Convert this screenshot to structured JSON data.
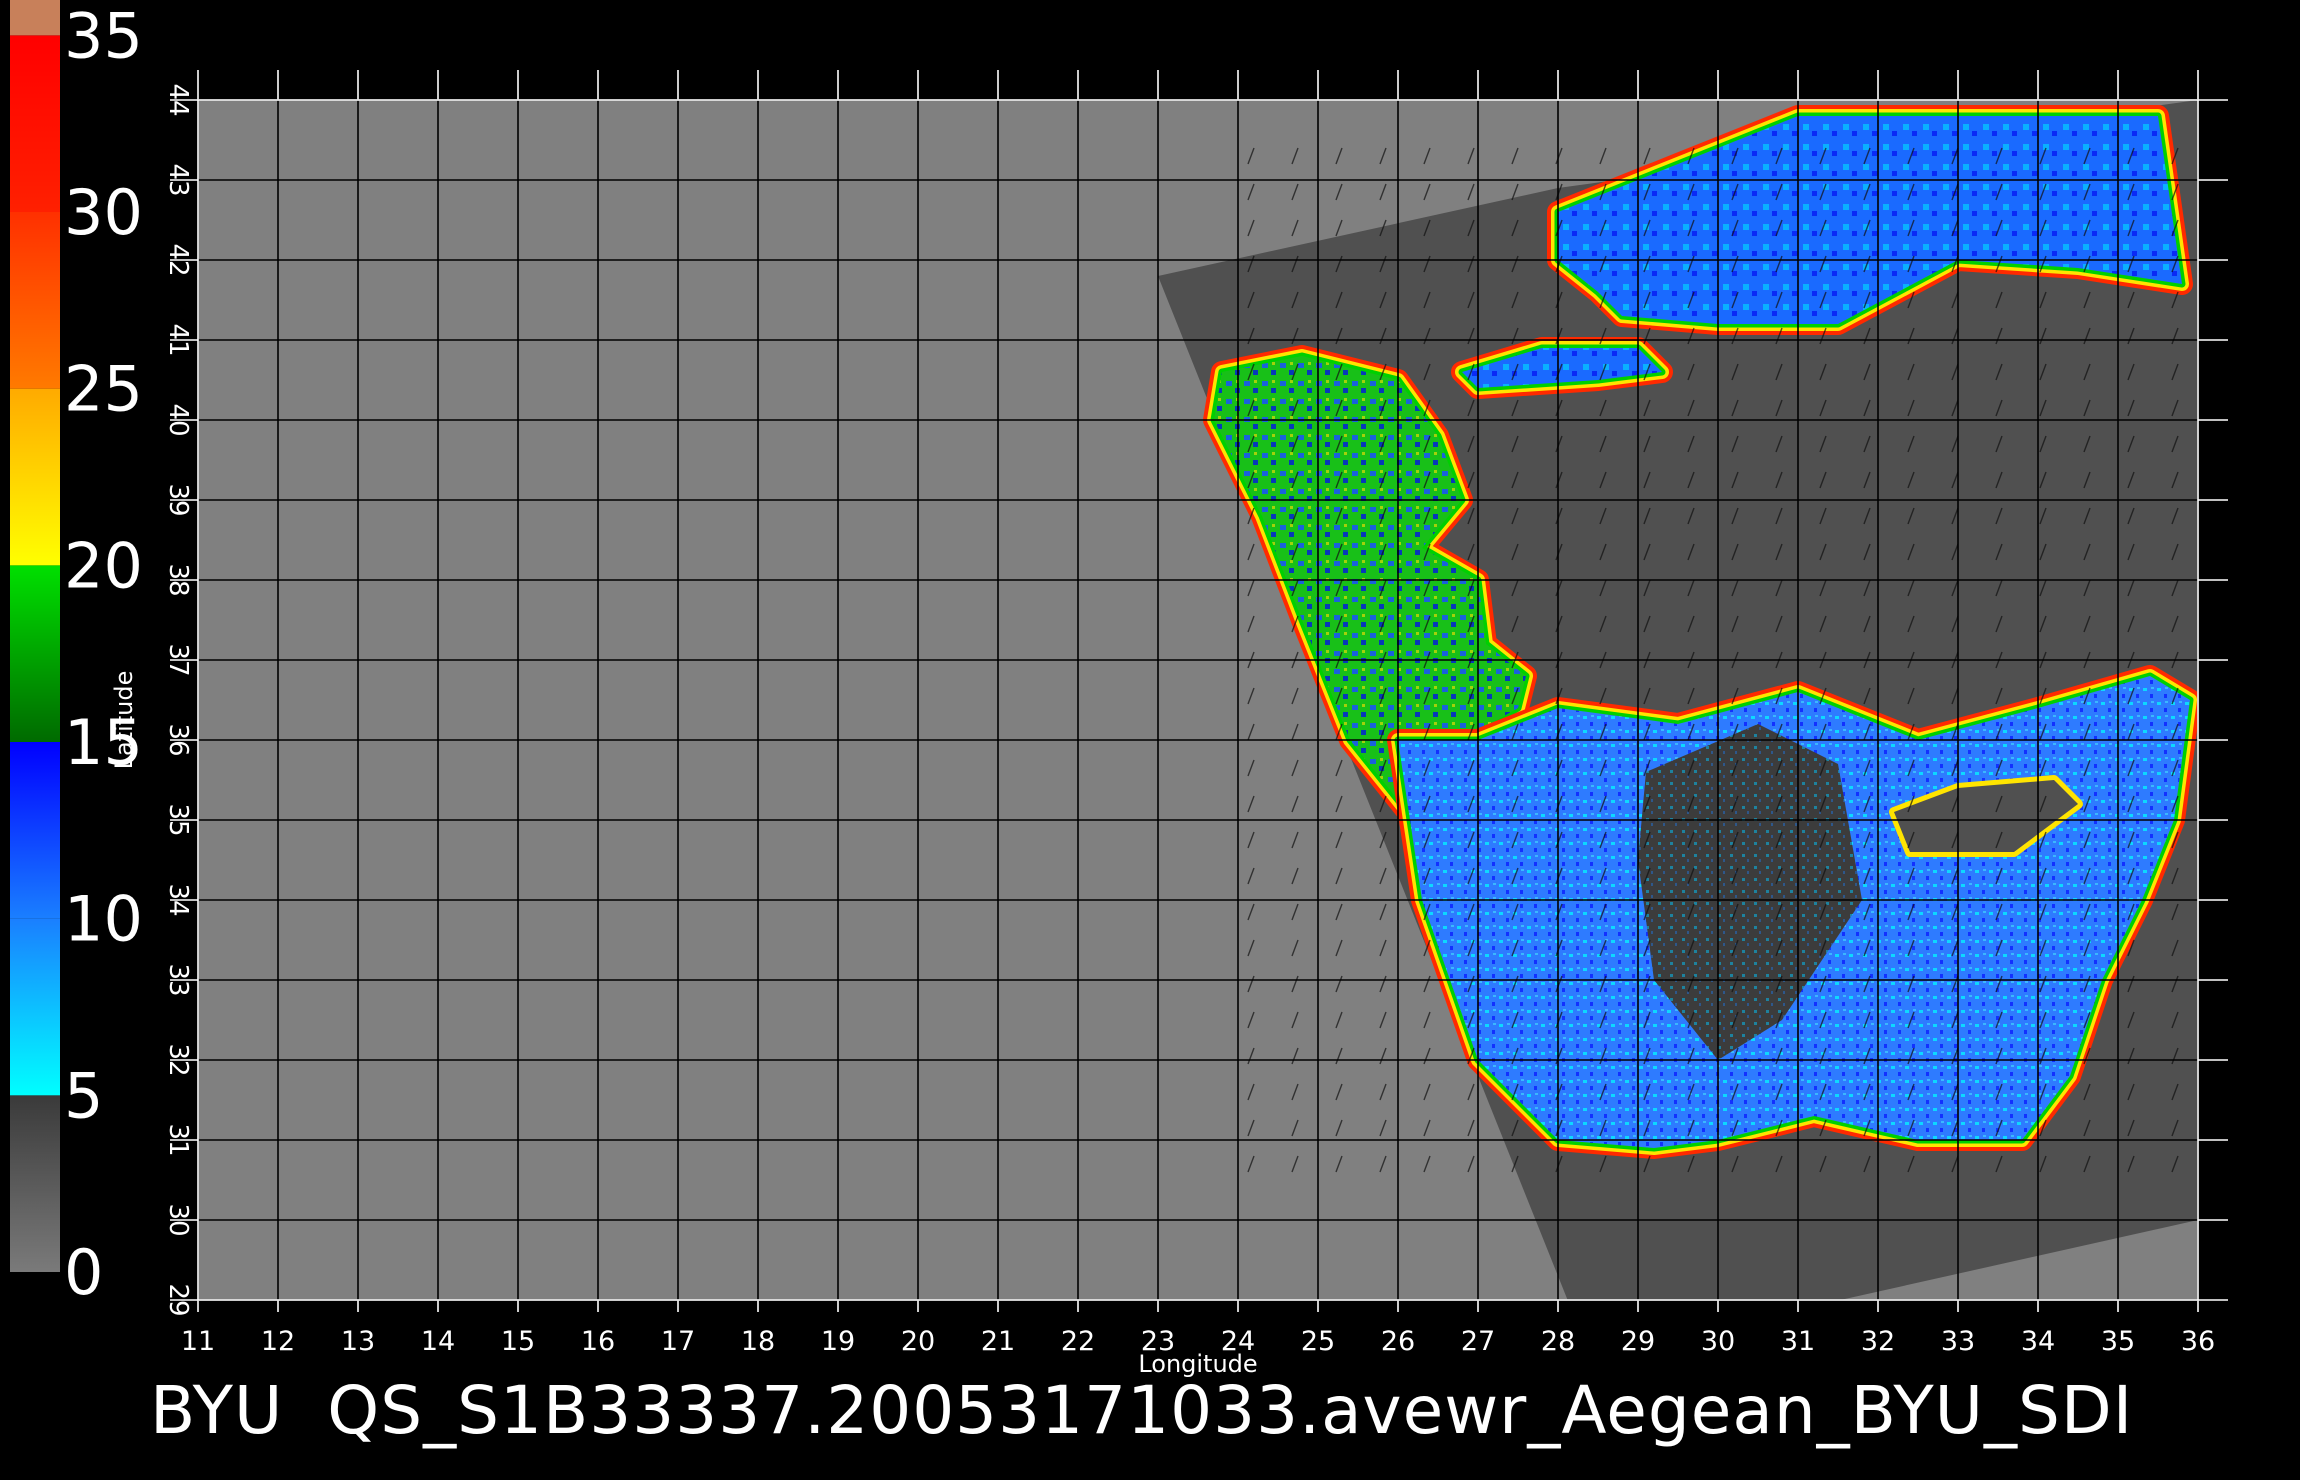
{
  "footer": {
    "caption_prefix": "BYU",
    "caption_file": "QS_S1B33337.20053171033.avewr_Aegean_BYU_SDI"
  },
  "colorbar": {
    "ticks": [
      "0",
      "5",
      "10",
      "15",
      "20",
      "25",
      "30",
      "35"
    ],
    "bands": [
      {
        "from": 0,
        "to": 5,
        "colors": [
          "#7a7a7a",
          "#3a3a3a"
        ]
      },
      {
        "from": 5,
        "to": 10,
        "colors": [
          "#00ffff",
          "#1a7fff"
        ]
      },
      {
        "from": 10,
        "to": 15,
        "colors": [
          "#1a7fff",
          "#0000ff"
        ]
      },
      {
        "from": 15,
        "to": 20,
        "colors": [
          "#006a00",
          "#00e000"
        ]
      },
      {
        "from": 20,
        "to": 25,
        "colors": [
          "#ffff00",
          "#ffaa00"
        ]
      },
      {
        "from": 25,
        "to": 30,
        "colors": [
          "#ff7a00",
          "#ff3000"
        ]
      },
      {
        "from": 30,
        "to": 35,
        "colors": [
          "#ff2000",
          "#ff0000"
        ]
      },
      {
        "from": 35,
        "to": 36,
        "colors": [
          "#c8805a",
          "#c8805a"
        ]
      }
    ]
  },
  "chart_data": {
    "type": "heatmap",
    "title": "",
    "xlabel": "Longitude",
    "ylabel": "Latitude",
    "xlim": [
      11,
      36
    ],
    "ylim": [
      29,
      44
    ],
    "xticks": [
      11,
      12,
      13,
      14,
      15,
      16,
      17,
      18,
      19,
      20,
      21,
      22,
      23,
      24,
      25,
      26,
      27,
      28,
      29,
      30,
      31,
      32,
      33,
      34,
      35,
      36
    ],
    "yticks": [
      29,
      30,
      31,
      32,
      33,
      34,
      35,
      36,
      37,
      38,
      39,
      40,
      41,
      42,
      43,
      44
    ],
    "grid": true,
    "colorscale": {
      "min": 0,
      "max": 35
    },
    "swath_polygon": [
      [
        23.0,
        41.8
      ],
      [
        28.0,
        42.9
      ],
      [
        36.0,
        44.0
      ],
      [
        36.0,
        30.0
      ],
      [
        28.4,
        28.3
      ]
    ],
    "regions": [
      {
        "name_hint": "black-sea",
        "dominant_value": 12,
        "polygon": [
          [
            28.0,
            42.6
          ],
          [
            29.5,
            43.2
          ],
          [
            31.0,
            43.8
          ],
          [
            33.0,
            43.8
          ],
          [
            35.5,
            43.8
          ],
          [
            35.8,
            41.7
          ],
          [
            34.5,
            41.9
          ],
          [
            33.0,
            42.0
          ],
          [
            31.5,
            41.2
          ],
          [
            30.0,
            41.2
          ],
          [
            28.8,
            41.3
          ],
          [
            28.5,
            41.6
          ],
          [
            28.0,
            42.0
          ]
        ]
      },
      {
        "name_hint": "marmara",
        "dominant_value": 12,
        "polygon": [
          [
            26.8,
            40.6
          ],
          [
            27.8,
            40.9
          ],
          [
            29.0,
            40.9
          ],
          [
            29.3,
            40.6
          ],
          [
            28.5,
            40.5
          ],
          [
            27.0,
            40.4
          ]
        ]
      },
      {
        "name_hint": "aegean",
        "dominant_value": 17,
        "polygon": [
          [
            23.8,
            40.6
          ],
          [
            24.8,
            40.8
          ],
          [
            26.0,
            40.5
          ],
          [
            26.5,
            39.8
          ],
          [
            26.8,
            39.0
          ],
          [
            26.3,
            38.4
          ],
          [
            27.0,
            38.0
          ],
          [
            27.1,
            37.2
          ],
          [
            27.6,
            36.8
          ],
          [
            27.5,
            36.4
          ],
          [
            26.8,
            36.0
          ],
          [
            27.3,
            34.8
          ],
          [
            26.2,
            35.0
          ],
          [
            25.4,
            36.0
          ],
          [
            24.8,
            37.5
          ],
          [
            24.3,
            38.8
          ],
          [
            23.7,
            40.0
          ]
        ]
      },
      {
        "name_hint": "levant-basin",
        "dominant_value": 10,
        "polygon": [
          [
            26.0,
            36.0
          ],
          [
            27.0,
            36.0
          ],
          [
            28.0,
            36.4
          ],
          [
            29.5,
            36.2
          ],
          [
            31.0,
            36.6
          ],
          [
            32.5,
            36.0
          ],
          [
            34.0,
            36.4
          ],
          [
            35.4,
            36.8
          ],
          [
            35.9,
            36.5
          ],
          [
            35.7,
            35.0
          ],
          [
            35.3,
            34.0
          ],
          [
            34.8,
            33.0
          ],
          [
            34.4,
            31.8
          ],
          [
            33.8,
            31.0
          ],
          [
            32.5,
            31.0
          ],
          [
            31.2,
            31.3
          ],
          [
            30.0,
            31.0
          ],
          [
            29.2,
            30.9
          ],
          [
            28.0,
            31.0
          ],
          [
            27.0,
            32.0
          ],
          [
            26.3,
            34.0
          ]
        ]
      }
    ],
    "holes": [
      {
        "name_hint": "cyprus",
        "polygon": [
          [
            32.2,
            35.1
          ],
          [
            33.0,
            35.4
          ],
          [
            34.2,
            35.5
          ],
          [
            34.5,
            35.2
          ],
          [
            33.7,
            34.6
          ],
          [
            32.4,
            34.6
          ]
        ]
      },
      {
        "name_hint": "low-wind-patch",
        "polygon": [
          [
            29.1,
            35.6
          ],
          [
            30.5,
            36.2
          ],
          [
            31.5,
            35.7
          ],
          [
            31.8,
            34.0
          ],
          [
            30.8,
            32.5
          ],
          [
            30.0,
            32.0
          ],
          [
            29.2,
            33.0
          ],
          [
            29.0,
            34.5
          ]
        ]
      }
    ]
  }
}
